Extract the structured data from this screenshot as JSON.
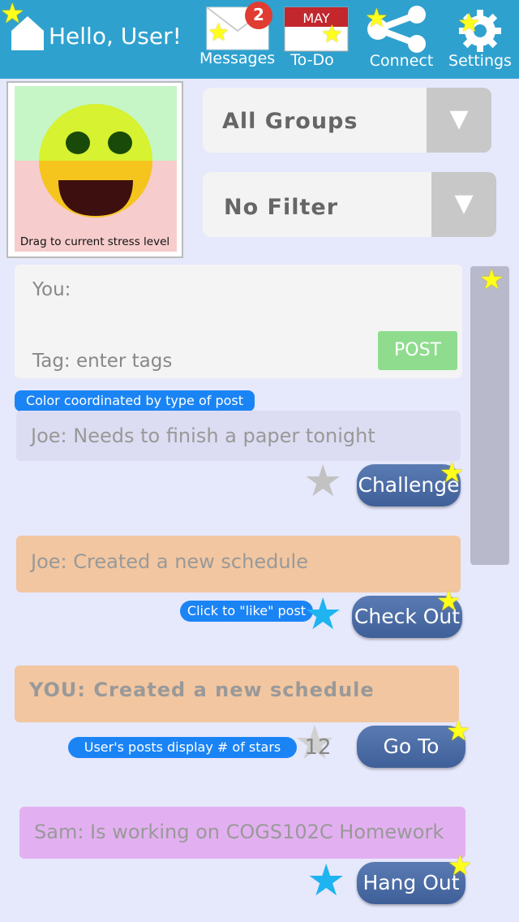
{
  "header": {
    "greeting": "Hello, User!",
    "messages_label": "Messages",
    "messages_badge": "2",
    "todo_label": "To-Do",
    "calendar_month": "MAY",
    "connect_label": "Connect",
    "settings_label": "Settings"
  },
  "stress": {
    "caption": "Drag to current stress level"
  },
  "filters": {
    "groups_value": "All Groups",
    "filter_value": "No Filter",
    "arrow_glyph": "▼"
  },
  "composer": {
    "you_label": "You:",
    "tag_placeholder": "Tag: enter tags",
    "post_button": "POST"
  },
  "tips": {
    "color_tip": "Color coordinated by type of post",
    "like_tip": "Click to \"like\" post",
    "stars_tip": "User's posts display # of stars"
  },
  "posts": [
    {
      "text": "Joe: Needs to finish a paper tonight",
      "action": "Challenge",
      "color": "#dcdcf2"
    },
    {
      "text": "Joe: Created a new schedule",
      "action": "Check Out",
      "color": "#f2c6a0"
    },
    {
      "text": "YOU: Created a new schedule",
      "action": "Go To",
      "color": "#f2c6a0",
      "star_count": "12"
    },
    {
      "text": "Sam: Is working on COGS102C Homework",
      "action": "Hang Out",
      "color": "#e2b0f0"
    }
  ],
  "colors": {
    "header": "#2fa1cf",
    "background": "#e6e8fc",
    "accent_star": "#ffff1a",
    "like_star": "#1eb4f0"
  }
}
